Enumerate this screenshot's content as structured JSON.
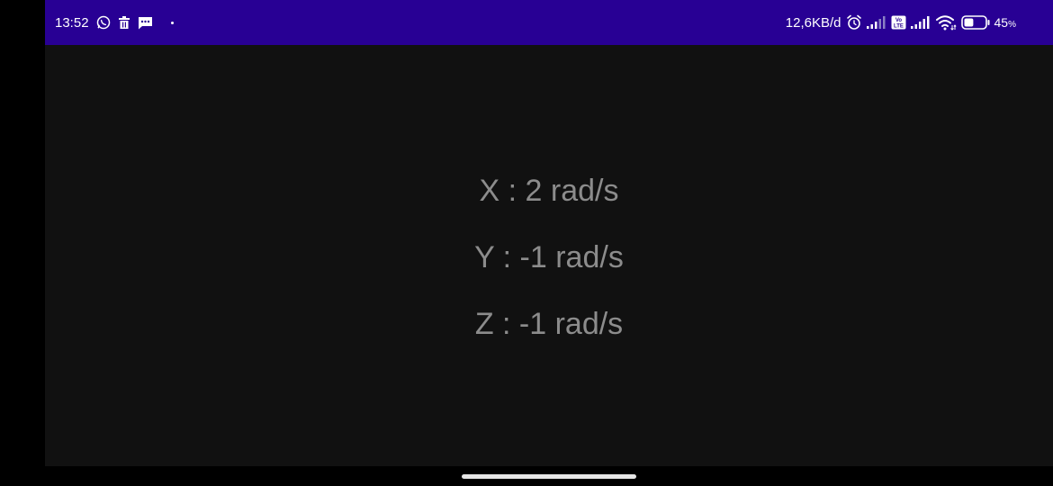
{
  "status_bar": {
    "time": "13:52",
    "left_icons": [
      "whatsapp-icon",
      "trash-icon",
      "message-icon",
      "dot-icon"
    ],
    "network_speed": "12,6KB/d",
    "right_icons": [
      "alarm-icon",
      "signal-icon",
      "volte-icon",
      "signal-icon",
      "wifi-icon",
      "battery-icon"
    ],
    "volte_label": "Vo LTE",
    "battery_percent": "45",
    "battery_unit": "%",
    "battery_level": 0.45,
    "background_color": "#280094"
  },
  "readings": {
    "x": "X : 2 rad/s",
    "y": "Y : -1 rad/s",
    "z": "Z : -1 rad/s",
    "text_color": "#8c8c8c",
    "background_color": "#111111"
  },
  "navigation": {
    "home_indicator": "home-indicator"
  }
}
